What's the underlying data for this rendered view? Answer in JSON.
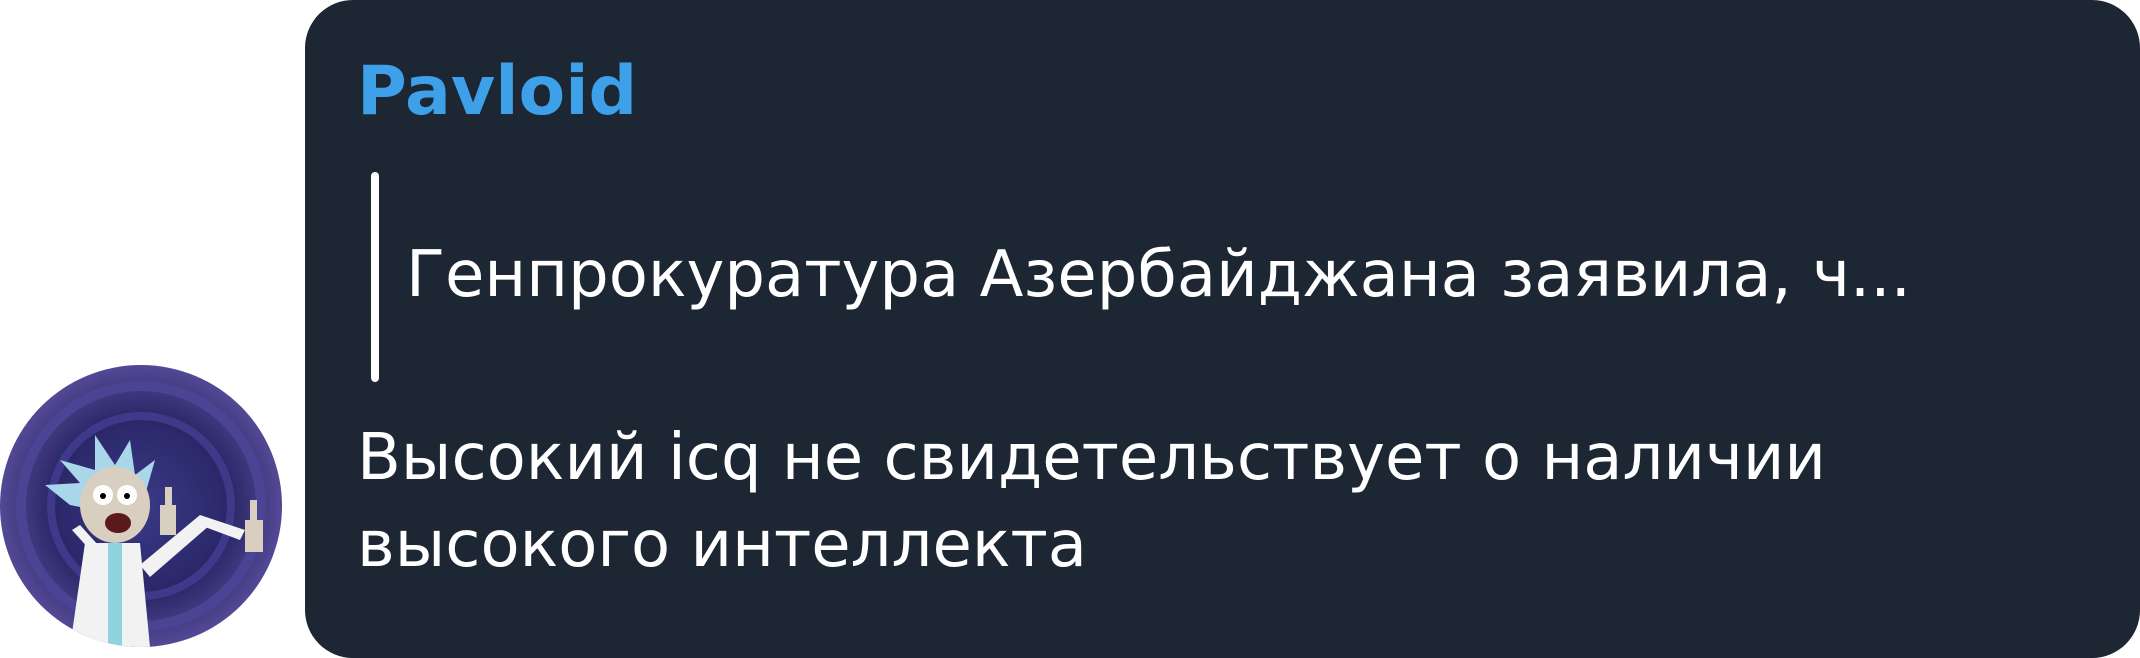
{
  "message": {
    "sender_name": "Pavloid",
    "reply_quote": "Генпрокуратура Азербайджана заявила, ч...",
    "text": "Высокий icq не свидетельствует о наличии высокого интеллекта"
  },
  "colors": {
    "bubble_background": "#1d2633",
    "sender_name": "#3da0e9",
    "text": "#ffffff",
    "page_background": "#ffffff"
  },
  "icons": {
    "avatar": "cartoon-scientist-avatar"
  }
}
